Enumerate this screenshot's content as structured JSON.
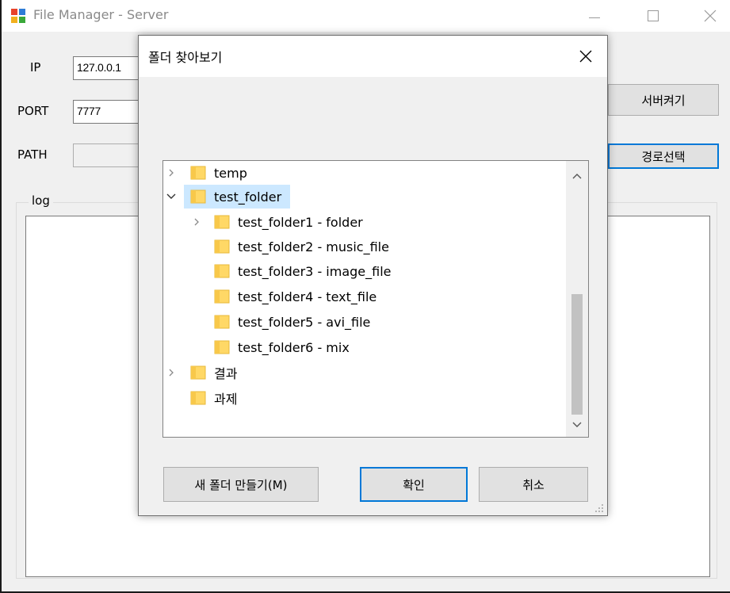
{
  "window": {
    "title": "File Manager - Server",
    "controls": {
      "minimize": "minimize",
      "maximize": "maximize",
      "close": "close"
    }
  },
  "form": {
    "ip_label": "IP",
    "ip_value": "127.0.0.1",
    "port_label": "PORT",
    "port_value": "7777",
    "path_label": "PATH",
    "path_value": "",
    "server_button": "서버켜기",
    "path_button": "경로선택",
    "log_label": "log"
  },
  "dialog": {
    "title": "폴더 찾아보기",
    "tree": [
      {
        "name": "temp",
        "expander": "collapsed"
      },
      {
        "name": "test_folder",
        "expander": "expanded",
        "selected": true
      },
      {
        "name": "test_folder1 - folder",
        "expander": "collapsed"
      },
      {
        "name": "test_folder2 - music_file",
        "expander": "none"
      },
      {
        "name": "test_folder3 - image_file",
        "expander": "none"
      },
      {
        "name": "test_folder4 - text_file",
        "expander": "none"
      },
      {
        "name": "test_folder5 - avi_file",
        "expander": "none"
      },
      {
        "name": "test_folder6 - mix",
        "expander": "none"
      },
      {
        "name": "결과",
        "expander": "collapsed"
      },
      {
        "name": "과제",
        "expander": "none"
      }
    ],
    "new_folder_button": "새 폴더 만들기(M)",
    "ok_button": "확인",
    "cancel_button": "취소"
  },
  "colors": {
    "accent": "#0078d7",
    "selection": "#cce8ff",
    "folder": "#ffd866"
  }
}
